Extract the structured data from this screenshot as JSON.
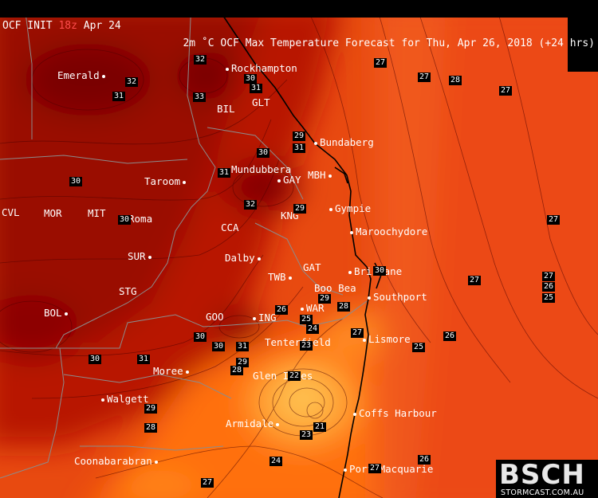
{
  "header": {
    "model_init": "OCF INIT",
    "init_hour": "18z",
    "init_date": "Apr 24",
    "title": "2m ˚C OCF Max Temperature Forecast for Thu, Apr 26, 2018 (+24 hrs)"
  },
  "colors": {
    "hot_dark": "#8c0000",
    "mid_red": "#d42400",
    "orange": "#ff6a00",
    "light_orange": "#ffb040",
    "label_bg": "#000000"
  },
  "cities": [
    {
      "name": "Emerald"
    },
    {
      "name": "Rockhampton"
    },
    {
      "name": "GLT"
    },
    {
      "name": "BIL"
    },
    {
      "name": "Bundaberg"
    },
    {
      "name": "Mundubbera"
    },
    {
      "name": "GAY"
    },
    {
      "name": "MBH"
    },
    {
      "name": "Taroom"
    },
    {
      "name": "Gympie"
    },
    {
      "name": "CVL"
    },
    {
      "name": "MOR"
    },
    {
      "name": "MIT"
    },
    {
      "name": "Roma"
    },
    {
      "name": "CCA"
    },
    {
      "name": "KNG"
    },
    {
      "name": "Maroochydore"
    },
    {
      "name": "Dalby"
    },
    {
      "name": "SUR"
    },
    {
      "name": "GAT"
    },
    {
      "name": "Brisbane"
    },
    {
      "name": "TWB"
    },
    {
      "name": "Boo Bea"
    },
    {
      "name": "Southport"
    },
    {
      "name": "STG"
    },
    {
      "name": "BOL"
    },
    {
      "name": "WAR"
    },
    {
      "name": "GOO"
    },
    {
      "name": "ING"
    },
    {
      "name": "Tenterfield"
    },
    {
      "name": "Lismore"
    },
    {
      "name": "Moree"
    },
    {
      "name": "Glen Innes"
    },
    {
      "name": "Walgett"
    },
    {
      "name": "Coffs Harbour"
    },
    {
      "name": "Armidale"
    },
    {
      "name": "Coonabarabran"
    },
    {
      "name": "Port Macquarie"
    }
  ],
  "contour_labels": [
    "32",
    "30",
    "31",
    "32",
    "31",
    "33",
    "27",
    "27",
    "28",
    "27",
    "29",
    "31",
    "30",
    "31",
    "30",
    "32",
    "29",
    "30",
    "30",
    "27",
    "27",
    "27",
    "26",
    "25",
    "29",
    "28",
    "26",
    "25",
    "26",
    "24",
    "27",
    "23",
    "25",
    "30",
    "30",
    "31",
    "30",
    "31",
    "29",
    "28",
    "22",
    "29",
    "21",
    "23",
    "28",
    "24",
    "27",
    "27",
    "26",
    "28"
  ],
  "logo": {
    "text_main": "BSCH",
    "text_sub": "STORMCAST.COM.AU"
  }
}
